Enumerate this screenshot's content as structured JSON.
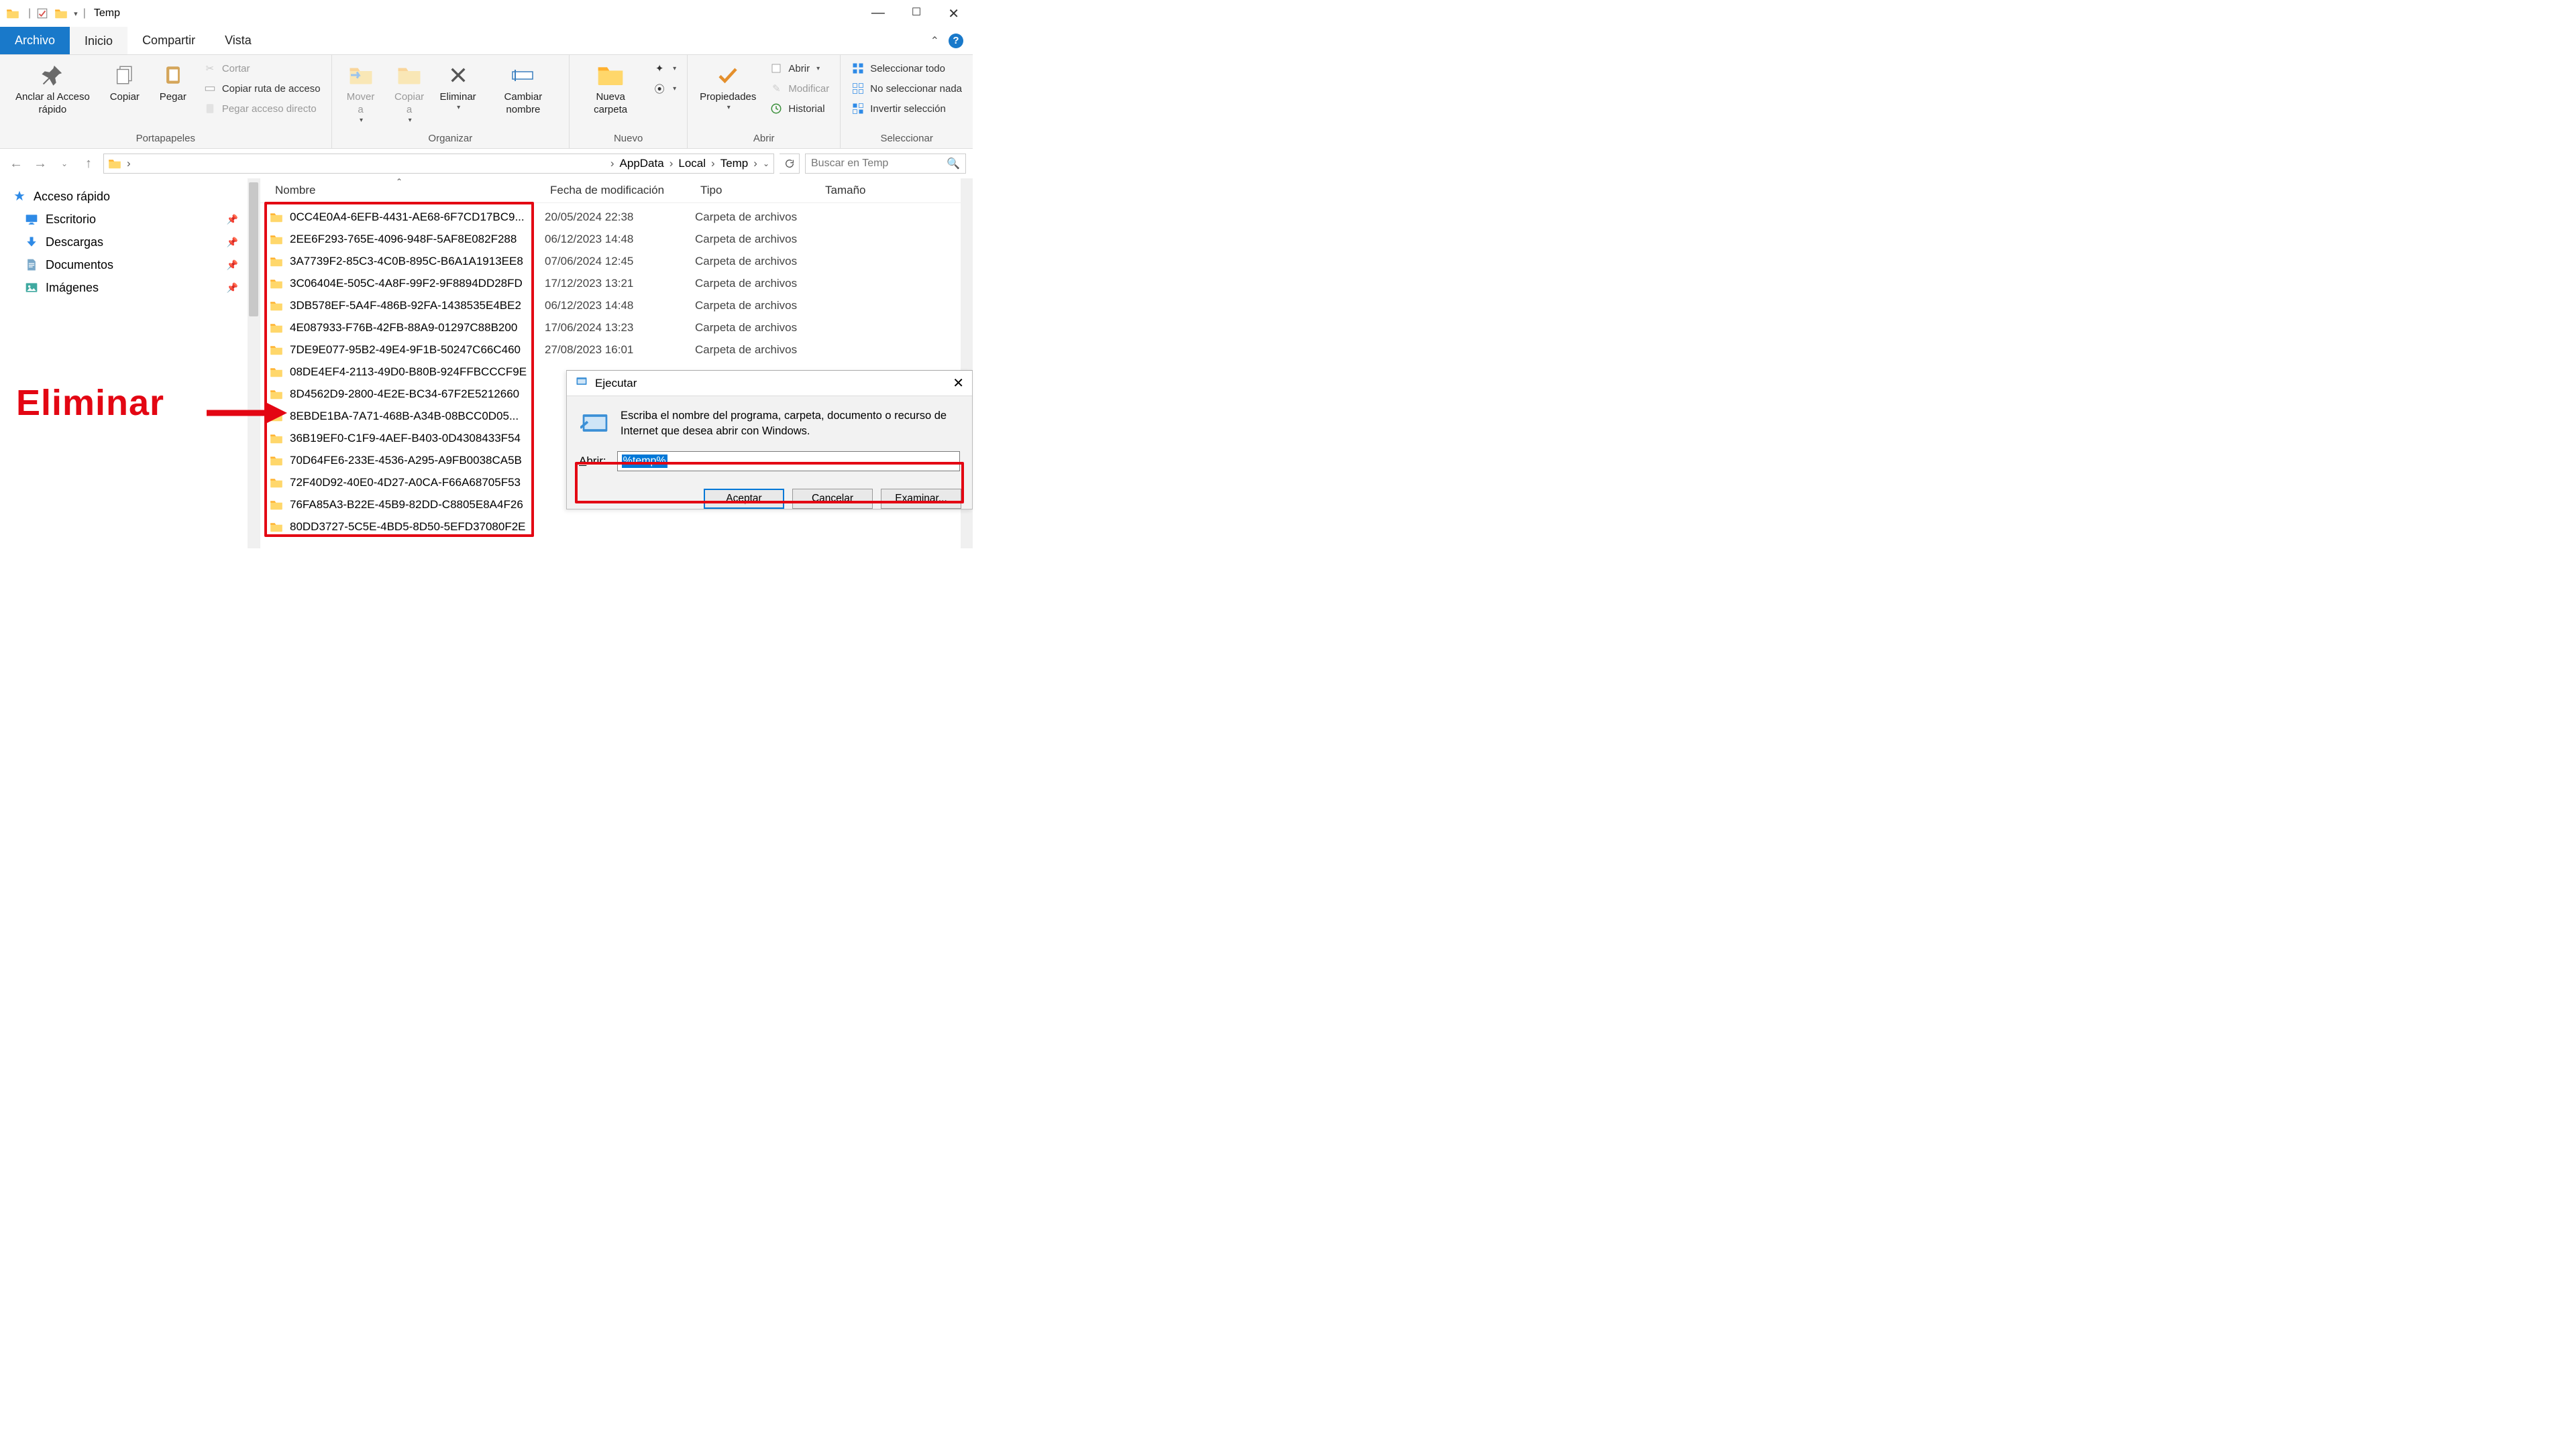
{
  "window": {
    "title": "Temp"
  },
  "tabs": {
    "file": "Archivo",
    "home": "Inicio",
    "share": "Compartir",
    "view": "Vista"
  },
  "ribbon": {
    "clipboard": {
      "label": "Portapapeles",
      "pin": "Anclar al Acceso rápido",
      "copy": "Copiar",
      "paste": "Pegar",
      "cut": "Cortar",
      "copypath": "Copiar ruta de acceso",
      "pasteshortcut": "Pegar acceso directo"
    },
    "organize": {
      "label": "Organizar",
      "moveto": "Mover a",
      "copyto": "Copiar a",
      "delete": "Eliminar",
      "rename": "Cambiar nombre"
    },
    "new": {
      "label": "Nuevo",
      "newfolder": "Nueva carpeta"
    },
    "open": {
      "label": "Abrir",
      "properties": "Propiedades",
      "open": "Abrir",
      "edit": "Modificar",
      "history": "Historial"
    },
    "select": {
      "label": "Seleccionar",
      "all": "Seleccionar todo",
      "none": "No seleccionar nada",
      "invert": "Invertir selección"
    }
  },
  "breadcrumb": {
    "p1": "AppData",
    "p2": "Local",
    "p3": "Temp"
  },
  "search": {
    "placeholder": "Buscar en Temp"
  },
  "tree": {
    "quick": "Acceso rápido",
    "desktop": "Escritorio",
    "downloads": "Descargas",
    "documents": "Documentos",
    "images": "Imágenes"
  },
  "columns": {
    "name": "Nombre",
    "date": "Fecha de modificación",
    "type": "Tipo",
    "size": "Tamaño"
  },
  "filetype": "Carpeta de archivos",
  "files": [
    {
      "name": "0CC4E0A4-6EFB-4431-AE68-6F7CD17BC9...",
      "date": "20/05/2024 22:38"
    },
    {
      "name": "2EE6F293-765E-4096-948F-5AF8E082F288",
      "date": "06/12/2023 14:48"
    },
    {
      "name": "3A7739F2-85C3-4C0B-895C-B6A1A1913EE8",
      "date": "07/06/2024 12:45"
    },
    {
      "name": "3C06404E-505C-4A8F-99F2-9F8894DD28FD",
      "date": "17/12/2023 13:21"
    },
    {
      "name": "3DB578EF-5A4F-486B-92FA-1438535E4BE2",
      "date": "06/12/2023 14:48"
    },
    {
      "name": "4E087933-F76B-42FB-88A9-01297C88B200",
      "date": "17/06/2024 13:23"
    },
    {
      "name": "7DE9E077-95B2-49E4-9F1B-50247C66C460",
      "date": "27/08/2023 16:01"
    },
    {
      "name": "08DE4EF4-2113-49D0-B80B-924FFBCCCF9E",
      "date": ""
    },
    {
      "name": "8D4562D9-2800-4E2E-BC34-67F2E5212660",
      "date": ""
    },
    {
      "name": "8EBDE1BA-7A71-468B-A34B-08BCC0D05...",
      "date": ""
    },
    {
      "name": "36B19EF0-C1F9-4AEF-B403-0D4308433F54",
      "date": ""
    },
    {
      "name": "70D64FE6-233E-4536-A295-A9FB0038CA5B",
      "date": ""
    },
    {
      "name": "72F40D92-40E0-4D27-A0CA-F66A68705F53",
      "date": ""
    },
    {
      "name": "76FA85A3-B22E-45B9-82DD-C8805E8A4F26",
      "date": ""
    },
    {
      "name": "80DD3727-5C5E-4BD5-8D50-5EFD37080F2E",
      "date": ""
    }
  ],
  "annotation": {
    "text": "Eliminar"
  },
  "run": {
    "title": "Ejecutar",
    "message": "Escriba el nombre del programa, carpeta, documento o recurso de Internet que desea abrir con Windows.",
    "openlabel_pre": "A",
    "openlabel_rest": "brir:",
    "value": "%temp%",
    "ok": "Aceptar",
    "cancel": "Cancelar",
    "browse": "Examinar..."
  }
}
